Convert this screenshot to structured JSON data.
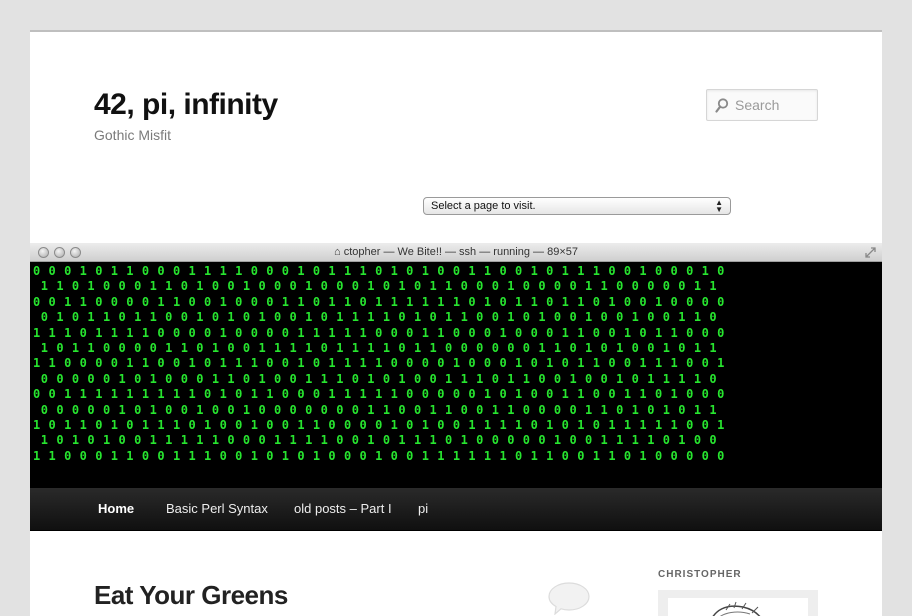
{
  "site": {
    "title": "42, pi, infinity",
    "description": "Gothic Misfit"
  },
  "search": {
    "placeholder": "Search",
    "icon": "search-icon"
  },
  "page_select": {
    "selected": "Select a page to visit."
  },
  "header_image": {
    "window_title": "ctopher — We Bite!! — ssh — running — 89×57",
    "text_color": "#27e52f",
    "binary_rows": [
      "0 0 0 1 0 1 1 0 0 0 1 1 1 1 0 0 0 1 0 1 1 1 0 1 0 1 0 0 1 1 0 0 1 0 1 1 1 0 0 1 0 0 0 1 0",
      " 1 1 0 1 0 0 0 1 1 0 1 0 0 1 0 0 0 1 0 0 0 1 0 1 0 1 1 0 0 0 1 0 0 0 0 1 1 0 0 0 0 0 1 1",
      "0 0 1 1 0 0 0 0 1 1 0 0 1 0 0 0 1 1 0 1 1 0 1 1 1 1 1 1 0 1 0 1 1 0 1 1 0 1 0 0 1 0 0 0 0",
      " 0 1 0 1 1 0 1 1 0 0 1 0 1 0 1 0 0 1 0 1 1 1 1 0 1 0 1 1 0 0 1 0 1 0 0 1 0 0 1 0 0 1 1 0",
      "1 1 1 0 1 1 1 1 0 0 0 0 1 0 0 0 0 1 1 1 1 1 0 0 0 1 1 0 0 0 1 0 0 0 1 1 0 0 1 0 1 1 0 0 0",
      " 1 0 1 1 0 0 0 0 1 1 0 1 0 0 1 1 1 1 0 1 1 1 1 0 1 1 0 0 0 0 0 0 1 1 0 1 0 1 0 0 1 0 1 1",
      "1 1 0 0 0 0 1 1 0 0 1 0 1 1 1 0 0 1 0 1 1 1 1 0 0 0 0 1 0 0 0 1 0 1 0 1 1 0 0 1 1 1 0 0 1",
      " 0 0 0 0 0 1 0 1 0 0 0 1 1 0 1 0 0 1 1 1 0 1 0 1 0 0 1 1 1 0 1 1 0 0 1 0 0 1 0 1 1 1 1 0",
      "0 0 1 1 1 1 1 1 1 1 1 0 1 0 1 1 0 0 0 1 1 1 1 1 0 0 0 0 0 1 0 1 0 0 1 1 0 0 1 1 0 1 0 0 0",
      " 0 0 0 0 0 1 0 1 0 0 1 0 0 1 0 0 0 0 0 0 0 1 1 0 0 1 1 0 0 1 1 0 0 0 0 1 1 0 1 0 1 0 1 1",
      "1 0 1 1 0 1 0 1 1 1 0 1 0 0 1 0 0 1 1 0 0 0 0 1 0 1 0 0 1 1 1 1 0 1 0 1 0 1 1 1 1 1 0 0 1",
      " 1 0 1 0 1 0 0 1 1 1 1 1 0 0 0 1 1 1 1 0 0 1 0 1 1 1 0 1 0 0 0 0 0 1 0 0 1 1 1 1 0 1 0 0",
      "1 1 0 0 0 1 1 0 0 1 1 1 0 0 1 0 1 0 1 0 0 0 1 0 0 1 1 1 1 1 1 0 1 1 0 0 1 1 0 1 0 0 0 0 0"
    ]
  },
  "nav": {
    "items": [
      {
        "label": "Home",
        "active": true
      },
      {
        "label": "Basic Perl Syntax",
        "active": false
      },
      {
        "label": "old posts – Part I",
        "active": false
      },
      {
        "label": "pi",
        "active": false
      }
    ]
  },
  "post": {
    "title": "Eat Your Greens"
  },
  "sidebar": {
    "heading": "CHRISTOPHER"
  }
}
